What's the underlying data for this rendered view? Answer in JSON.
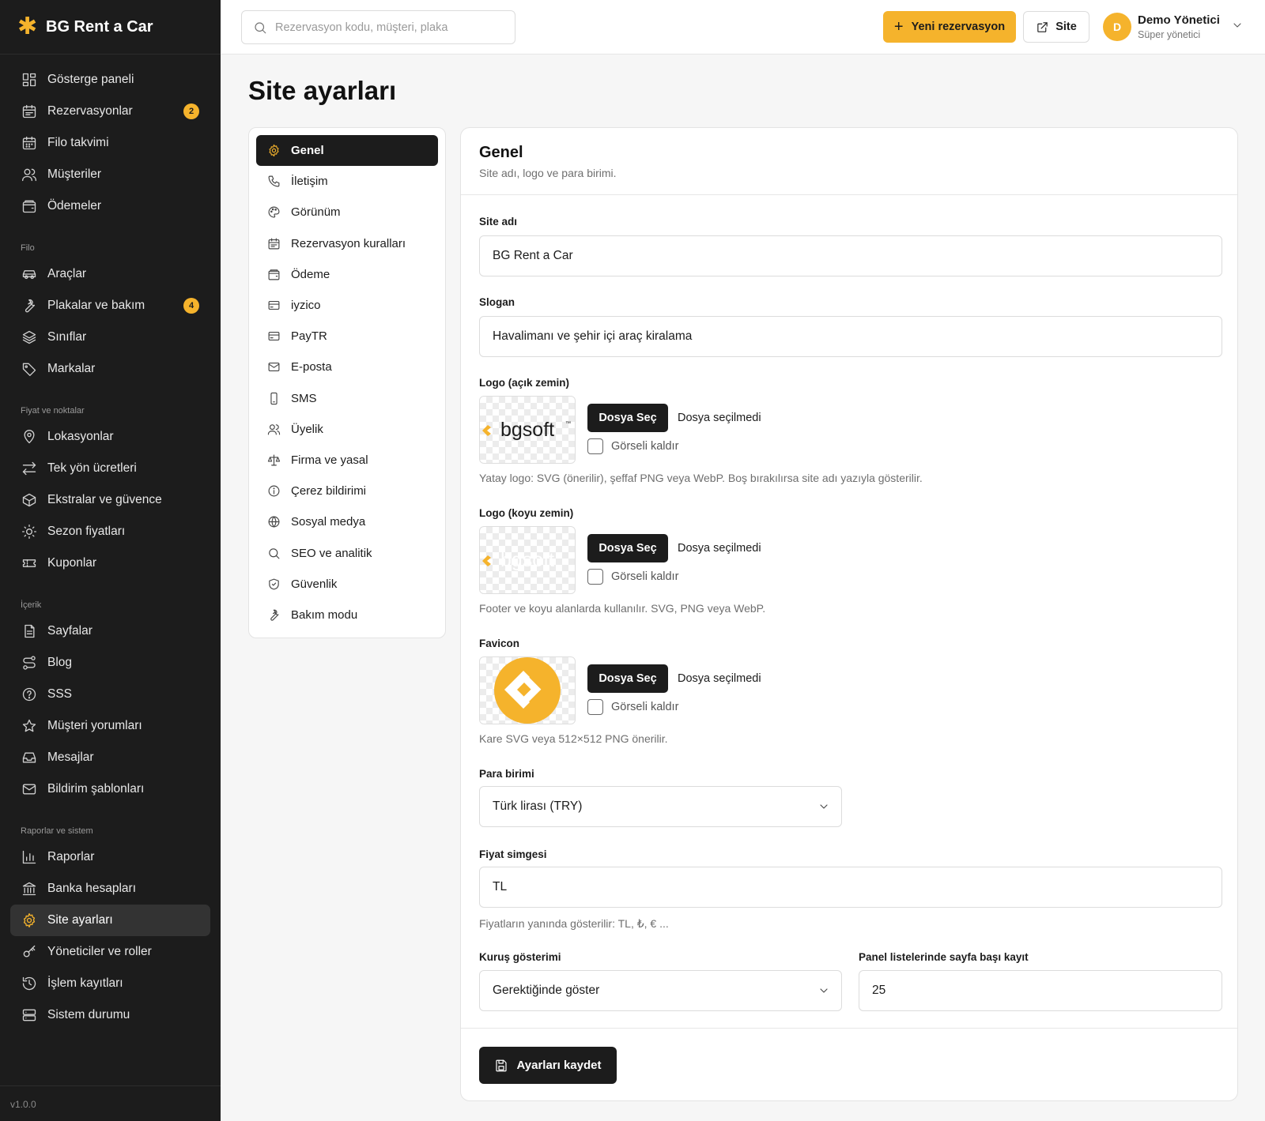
{
  "brand": {
    "name": "BG Rent a Car"
  },
  "sidebar": {
    "items_main": [
      {
        "label": "Gösterge paneli",
        "icon": "dashboard-icon"
      },
      {
        "label": "Rezervasyonlar",
        "icon": "calendar-icon",
        "badge": "2"
      },
      {
        "label": "Filo takvimi",
        "icon": "calendar-grid-icon"
      },
      {
        "label": "Müşteriler",
        "icon": "users-icon"
      },
      {
        "label": "Ödemeler",
        "icon": "wallet-icon"
      }
    ],
    "section_fleet": "Filo",
    "items_fleet": [
      {
        "label": "Araçlar",
        "icon": "car-icon"
      },
      {
        "label": "Plakalar ve bakım",
        "icon": "wrench-icon",
        "badge": "4"
      },
      {
        "label": "Sınıflar",
        "icon": "layers-icon"
      },
      {
        "label": "Markalar",
        "icon": "tag-icon"
      }
    ],
    "section_price": "Fiyat ve noktalar",
    "items_price": [
      {
        "label": "Lokasyonlar",
        "icon": "map-pin-icon"
      },
      {
        "label": "Tek yön ücretleri",
        "icon": "arrows-icon"
      },
      {
        "label": "Ekstralar ve güvence",
        "icon": "box-icon"
      },
      {
        "label": "Sezon fiyatları",
        "icon": "sun-icon"
      },
      {
        "label": "Kuponlar",
        "icon": "ticket-icon"
      }
    ],
    "section_content": "İçerik",
    "items_content": [
      {
        "label": "Sayfalar",
        "icon": "file-icon"
      },
      {
        "label": "Blog",
        "icon": "route-icon"
      },
      {
        "label": "SSS",
        "icon": "help-icon"
      },
      {
        "label": "Müşteri yorumları",
        "icon": "star-icon"
      },
      {
        "label": "Mesajlar",
        "icon": "inbox-icon"
      },
      {
        "label": "Bildirim şablonları",
        "icon": "mail-icon"
      }
    ],
    "section_reports": "Raporlar ve sistem",
    "items_reports": [
      {
        "label": "Raporlar",
        "icon": "chart-icon"
      },
      {
        "label": "Banka hesapları",
        "icon": "bank-icon"
      },
      {
        "label": "Site ayarları",
        "icon": "gear-icon",
        "active": true
      },
      {
        "label": "Yöneticiler ve roller",
        "icon": "key-icon"
      },
      {
        "label": "İşlem kayıtları",
        "icon": "history-icon"
      },
      {
        "label": "Sistem durumu",
        "icon": "server-icon"
      }
    ],
    "version": "v1.0.0"
  },
  "topbar": {
    "search_placeholder": "Rezervasyon kodu, müşteri, plaka",
    "new_button": "Yeni rezervasyon",
    "site_button": "Site",
    "user_initial": "D",
    "user_name": "Demo Yönetici",
    "user_role": "Süper yönetici"
  },
  "page": {
    "title": "Site ayarları"
  },
  "settings_nav": [
    {
      "label": "Genel",
      "icon": "gear-icon",
      "active": true
    },
    {
      "label": "İletişim",
      "icon": "phone-icon"
    },
    {
      "label": "Görünüm",
      "icon": "palette-icon"
    },
    {
      "label": "Rezervasyon kuralları",
      "icon": "calendar-icon"
    },
    {
      "label": "Ödeme",
      "icon": "wallet-icon"
    },
    {
      "label": "iyzico",
      "icon": "card-icon"
    },
    {
      "label": "PayTR",
      "icon": "card-icon"
    },
    {
      "label": "E-posta",
      "icon": "mail-icon"
    },
    {
      "label": "SMS",
      "icon": "phone-device-icon"
    },
    {
      "label": "Üyelik",
      "icon": "users-icon"
    },
    {
      "label": "Firma ve yasal",
      "icon": "scale-icon"
    },
    {
      "label": "Çerez bildirimi",
      "icon": "info-icon"
    },
    {
      "label": "Sosyal medya",
      "icon": "globe-icon"
    },
    {
      "label": "SEO ve analitik",
      "icon": "search-icon"
    },
    {
      "label": "Güvenlik",
      "icon": "shield-icon"
    },
    {
      "label": "Bakım modu",
      "icon": "wrench-icon"
    }
  ],
  "panel": {
    "title": "Genel",
    "subtitle": "Site adı, logo ve para birimi.",
    "site_name_label": "Site adı",
    "site_name_value": "BG Rent a Car",
    "slogan_label": "Slogan",
    "slogan_value": "Havalimanı ve şehir içi araç kiralama",
    "logo_light_label": "Logo (açık zemin)",
    "logo_light_hint": "Yatay logo: SVG (önerilir), şeffaf PNG veya WebP. Boş bırakılırsa site adı yazıyla gösterilir.",
    "logo_dark_label": "Logo (koyu zemin)",
    "logo_dark_hint": "Footer ve koyu alanlarda kullanılır. SVG, PNG veya WebP.",
    "favicon_label": "Favicon",
    "favicon_hint": "Kare SVG veya 512×512 PNG önerilir.",
    "file_button": "Dosya Seç",
    "file_status": "Dosya seçilmedi",
    "remove_image": "Görseli kaldır",
    "logo_text": "bgsoft",
    "currency_label": "Para birimi",
    "currency_value": "Türk lirası (TRY)",
    "price_symbol_label": "Fiyat simgesi",
    "price_symbol_value": "TL",
    "price_symbol_hint": "Fiyatların yanında gösterilir: TL, ₺, € ...",
    "cents_label": "Kuruş gösterimi",
    "cents_value": "Gerektiğinde göster",
    "per_page_label": "Panel listelerinde sayfa başı kayıt",
    "per_page_value": "25",
    "save_button": "Ayarları kaydet"
  },
  "colors": {
    "accent": "#f5b32c",
    "sidebar_bg": "#1c1c1c",
    "dark": "#1c1c1c"
  }
}
